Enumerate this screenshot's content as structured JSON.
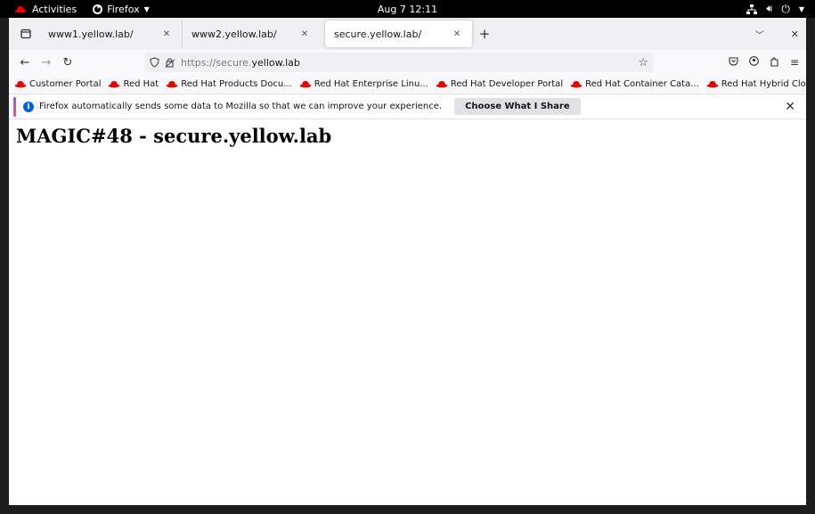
{
  "topbar": {
    "activities": "Activities",
    "app_name": "Firefox",
    "clock": "Aug 7  12:11"
  },
  "tabs": [
    {
      "title": "www1.yellow.lab/"
    },
    {
      "title": "www2.yellow.lab/"
    },
    {
      "title": "secure.yellow.lab/"
    }
  ],
  "urlbar": {
    "protocol": "https://secure.",
    "host": "yellow.lab"
  },
  "bookmarks": [
    "Customer Portal",
    "Red Hat",
    "Red Hat Products Docu...",
    "Red Hat Enterprise Linu...",
    "Red Hat Developer Portal",
    "Red Hat Container Cata...",
    "Red Hat Hybrid Cloud ..."
  ],
  "notification": {
    "message": "Firefox automatically sends some data to Mozilla so that we can improve your experience.",
    "button": "Choose What I Share"
  },
  "page": {
    "heading": "MAGIC#48 - secure.yellow.lab"
  },
  "colors": {
    "redhat": "#ee0000",
    "accent_blue": "#0060df"
  }
}
